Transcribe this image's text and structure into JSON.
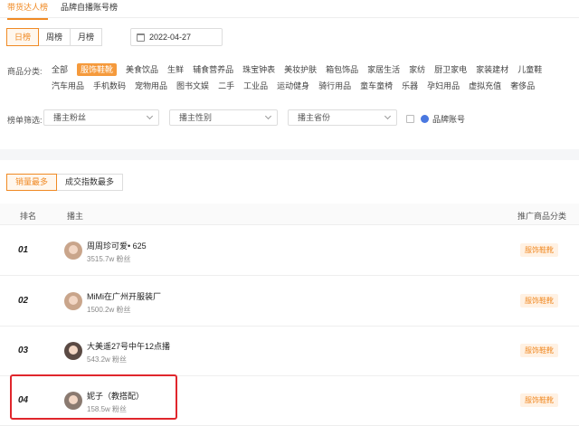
{
  "top_tabs": [
    "带货达人榜",
    "品牌自播账号榜"
  ],
  "period": {
    "buttons": [
      "日榜",
      "周榜",
      "月榜"
    ],
    "date": "2022-04-27"
  },
  "categories": {
    "label": "商品分类:",
    "row1": [
      "全部",
      "服饰鞋靴",
      "美食饮品",
      "生鲜",
      "辅食营养品",
      "珠宝钟表",
      "美妆护肤",
      "箱包饰品",
      "家居生活",
      "家纺",
      "厨卫家电",
      "家装建材",
      "儿童鞋"
    ],
    "row2": [
      "汽车用品",
      "手机数码",
      "宠物用品",
      "图书文娱",
      "二手",
      "工业品",
      "运动健身",
      "骑行用品",
      "童车童椅",
      "乐器",
      "孕妇用品",
      "虚拟充值",
      "奢侈品"
    ]
  },
  "filters": {
    "label": "榜单筛选:",
    "fans": "播主粉丝",
    "gender": "播主性别",
    "province": "播主省份",
    "brand": "品牌账号"
  },
  "sort": [
    "销量最多",
    "成交指数最多"
  ],
  "table": {
    "headers": {
      "rank": "排名",
      "host": "播主",
      "category": "推广商品分类"
    },
    "rows": [
      {
        "rank": "01",
        "name": "周周珍可爱• 625",
        "fans": "3515.7w 粉丝",
        "category": "服饰鞋靴"
      },
      {
        "rank": "02",
        "name": "MiMi在广州开服装厂",
        "fans": "1500.2w 粉丝",
        "category": "服饰鞋靴"
      },
      {
        "rank": "03",
        "name": "大美遥27号中午12点播",
        "fans": "543.2w 粉丝",
        "category": "服饰鞋靴"
      },
      {
        "rank": "04",
        "name": "妮子（教搭配）",
        "fans": "158.5w 粉丝",
        "category": "服饰鞋靴"
      }
    ]
  },
  "colors": {
    "accent": "#f08a24",
    "highlight": "#e0262c"
  }
}
